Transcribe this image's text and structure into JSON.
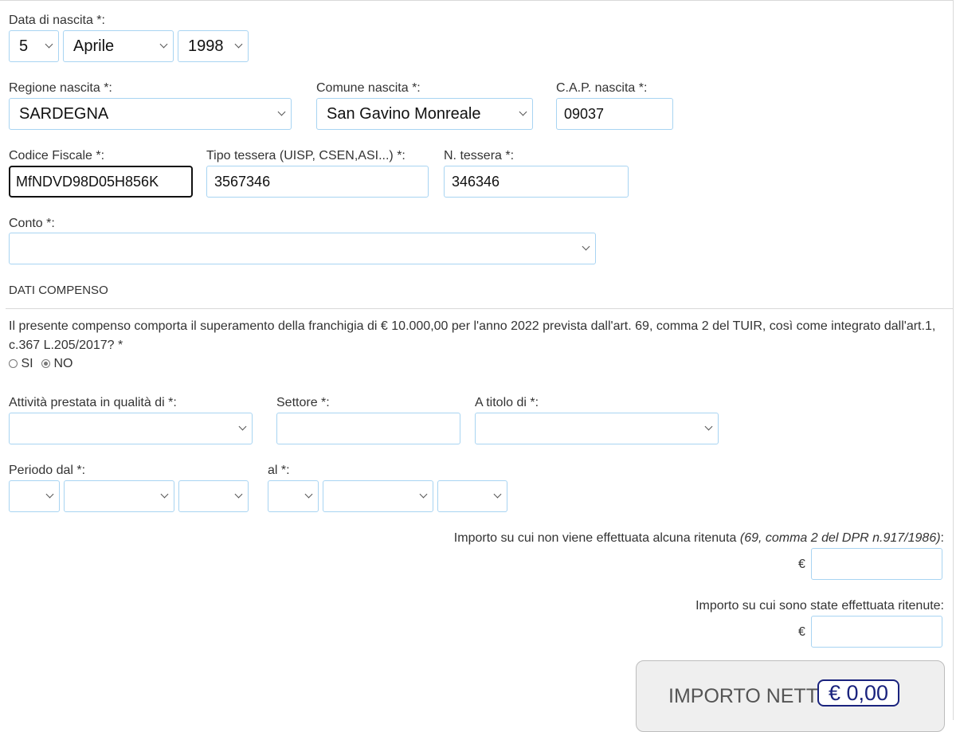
{
  "birth_date": {
    "label": "Data di nascita *:",
    "day": "5",
    "month": "Aprile",
    "year": "1998"
  },
  "birth_place": {
    "region_label": "Regione nascita *:",
    "region_value": "SARDEGNA",
    "comune_label": "Comune nascita *:",
    "comune_value": "San Gavino Monreale",
    "cap_label": "C.A.P. nascita *:",
    "cap_value": "09037"
  },
  "ids": {
    "cf_label": "Codice Fiscale *:",
    "cf_value": "MfNDVD98D05H856K",
    "tipo_label": "Tipo tessera (UISP, CSEN,ASI...) *:",
    "tipo_value": "3567346",
    "ntessera_label": "N. tessera *:",
    "ntessera_value": "346346"
  },
  "conto": {
    "label": "Conto *:",
    "value": ""
  },
  "section_title": "DATI COMPENSO",
  "franchigia": {
    "question": "Il presente compenso comporta il superamento della franchigia di € 10.000,00 per l'anno 2022 prevista dall'art. 69, comma 2 del TUIR, così come integrato dall'art.1, c.367 L.205/2017? *",
    "option_si": "SI",
    "option_no": "NO",
    "selected": "NO"
  },
  "attivita": {
    "label": "Attività prestata in qualità di *:",
    "settore_label": "Settore *:",
    "titolo_label": "A titolo di *:"
  },
  "periodo": {
    "dal_label": "Periodo dal *:",
    "al_label": "al *:"
  },
  "importi": {
    "no_ritenuta_label": "Importo su cui non viene effettuata alcuna ritenuta",
    "no_ritenuta_note": "(69, comma 2 del DPR n.917/1986)",
    "ritenute_label": "Importo su cui sono state effettuata ritenute:",
    "currency": "€"
  },
  "netto": {
    "label": "IMPORTO NETTO:",
    "value": "€ 0,00"
  },
  "colors": {
    "field_border": "#a8d4f2",
    "netto_accent": "#1a237e"
  }
}
